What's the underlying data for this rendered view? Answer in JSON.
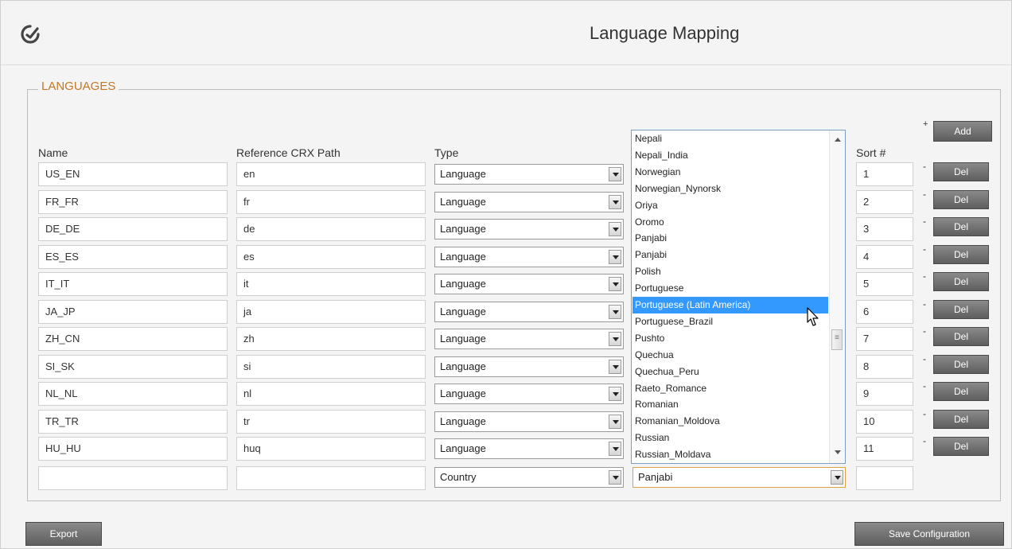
{
  "header": {
    "title": "Language Mapping"
  },
  "section": {
    "legend": "LANGUAGES"
  },
  "columns": {
    "name": "Name",
    "path": "Reference CRX Path",
    "type": "Type",
    "sort": "Sort #"
  },
  "add_button": {
    "label": "Add",
    "prefix": "+"
  },
  "rows": [
    {
      "name": "US_EN",
      "path": "en",
      "type": "Language",
      "sort": "1",
      "del": "Del",
      "minus": "-"
    },
    {
      "name": "FR_FR",
      "path": "fr",
      "type": "Language",
      "sort": "2",
      "del": "Del",
      "minus": "-"
    },
    {
      "name": "DE_DE",
      "path": "de",
      "type": "Language",
      "sort": "3",
      "del": "Del",
      "minus": "-"
    },
    {
      "name": "ES_ES",
      "path": "es",
      "type": "Language",
      "sort": "4",
      "del": "Del",
      "minus": "-"
    },
    {
      "name": "IT_IT",
      "path": "it",
      "type": "Language",
      "sort": "5",
      "del": "Del",
      "minus": "-"
    },
    {
      "name": "JA_JP",
      "path": "ja",
      "type": "Language",
      "sort": "6",
      "del": "Del",
      "minus": "-"
    },
    {
      "name": "ZH_CN",
      "path": "zh",
      "type": "Language",
      "sort": "7",
      "del": "Del",
      "minus": "-"
    },
    {
      "name": "SI_SK",
      "path": "si",
      "type": "Language",
      "sort": "8",
      "del": "Del",
      "minus": "-"
    },
    {
      "name": "NL_NL",
      "path": "nl",
      "type": "Language",
      "sort": "9",
      "del": "Del",
      "minus": "-"
    },
    {
      "name": "TR_TR",
      "path": "tr",
      "type": "Language",
      "sort": "10",
      "del": "Del",
      "minus": "-"
    },
    {
      "name": "HU_HU",
      "path": "huq",
      "type": "Language",
      "sort": "11",
      "del": "Del",
      "minus": "-"
    }
  ],
  "new_row": {
    "name": "",
    "path": "",
    "type": "Country",
    "language": "Panjabi",
    "sort": ""
  },
  "dropdown": {
    "items": [
      "Nepali",
      "Nepali_India",
      "Norwegian",
      "Norwegian_Nynorsk",
      "Oriya",
      "Oromo",
      "Panjabi",
      "Panjabi",
      "Polish",
      "Portuguese",
      "Portuguese (Latin America)",
      "Portuguese_Brazil",
      "Pushto",
      "Quechua",
      "Quechua_Peru",
      "Raeto_Romance",
      "Romanian",
      "Romanian_Moldova",
      "Russian",
      "Russian_Moldava"
    ],
    "highlighted": "Portuguese (Latin America)",
    "highlight_color": "#3399ff"
  },
  "footer": {
    "export": "Export",
    "save": "Save Configuration"
  },
  "colors": {
    "legend": "#c8761f",
    "button": "#6e6e6e"
  },
  "icons": {
    "logo": "cq-logo-icon",
    "cursor": "mouse-pointer-icon"
  }
}
